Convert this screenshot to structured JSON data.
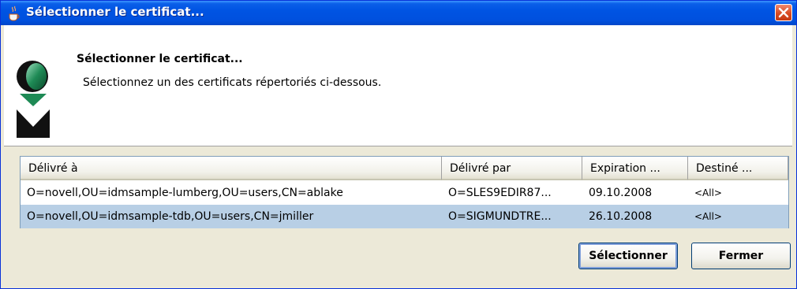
{
  "window": {
    "title": "Sélectionner le certificat..."
  },
  "header": {
    "title": "Sélectionner le certificat...",
    "description": "Sélectionnez un des certificats répertoriés ci-dessous."
  },
  "table": {
    "columns": [
      "Délivré à",
      "Délivré par",
      "Expiration ...",
      "Destiné ..."
    ],
    "rows": [
      {
        "issued_to": "O=novell,OU=idmsample-lumberg,OU=users,CN=ablake",
        "issued_by": "O=SLES9EDIR87...",
        "expiration": "09.10.2008",
        "intended": "<All>",
        "selected": false
      },
      {
        "issued_to": "O=novell,OU=idmsample-tdb,OU=users,CN=jmiller",
        "issued_by": "O=SIGMUNDTRE...",
        "expiration": "26.10.2008",
        "intended": "<All>",
        "selected": true
      }
    ]
  },
  "buttons": {
    "select": "Sélectionner",
    "close": "Fermer"
  },
  "icons": {
    "title_icon": "java-cup-icon",
    "close_icon": "close-icon",
    "logo": "novell-logo"
  },
  "colors": {
    "titlebar": "#0054e3",
    "selection": "#b8cfe5",
    "close_button": "#d84a22"
  }
}
